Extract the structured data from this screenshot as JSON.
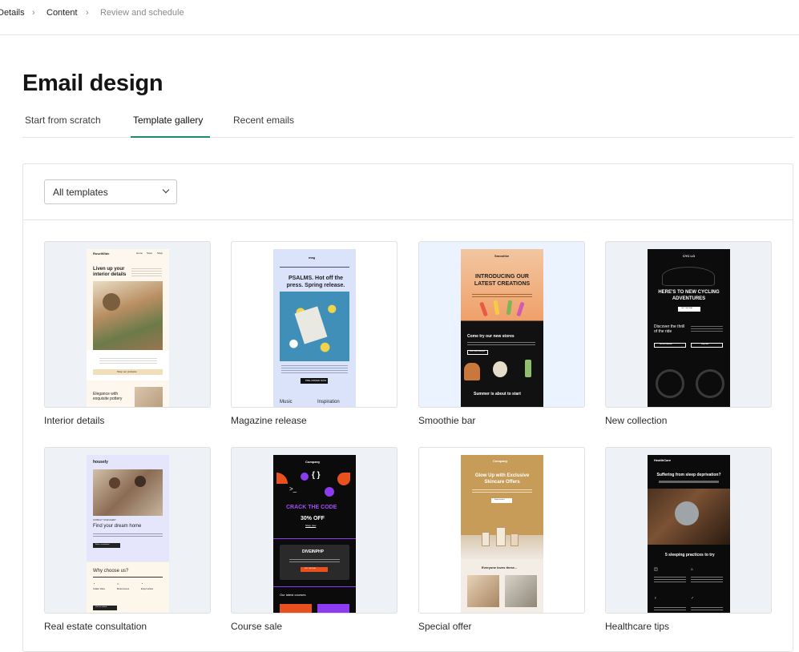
{
  "breadcrumb": {
    "items": [
      {
        "label": "Details",
        "state": "done"
      },
      {
        "label": "Content",
        "state": "done"
      },
      {
        "label": "Review and schedule",
        "state": "todo"
      }
    ]
  },
  "page_title": "Email design",
  "tabs": [
    {
      "label": "Start from scratch",
      "active": false
    },
    {
      "label": "Template gallery",
      "active": true
    },
    {
      "label": "Recent emails",
      "active": false
    }
  ],
  "filter": {
    "selected": "All templates"
  },
  "accent_color": "#1e8a6e",
  "templates": [
    {
      "name": "Interior details",
      "bg": "#eef2f7",
      "preview": {
        "brand": "RoseWilde",
        "nav": [
          "Home",
          "Store",
          "Shop"
        ],
        "headline": "Liven up your interior details",
        "button": "Shop our products",
        "footer_heading": "Elegance with exquisite pottery"
      }
    },
    {
      "name": "Magazine release",
      "bg": "#ffffff",
      "preview": {
        "brand": "mag",
        "headline": "PSALMS. Hot off the press. Spring release.",
        "button": "PRE-ORDER NOW",
        "col1": "Music",
        "col2": "Inspiration"
      }
    },
    {
      "name": "Smoothie bar",
      "bg": "#eaf3ff",
      "preview": {
        "brand": "Smoothie",
        "headline": "INTRODUCING OUR LATEST CREATIONS",
        "subhead": "Come try our new stores",
        "button": "Find a store near you",
        "footer": "Summer is about to start"
      }
    },
    {
      "name": "New collection",
      "bg": "#eef2f7",
      "preview": {
        "brand": "CYC LO",
        "headline": "HERE'S TO NEW CYCLING ADVENTURES",
        "button": "GET THE DEAL",
        "body": "Discover the thrill of the ride",
        "btn_a": "See the collection",
        "btn_b": "Shop now"
      }
    },
    {
      "name": "Real estate consultation",
      "bg": "#eef2f7",
      "preview": {
        "brand": "housely",
        "kicker": "CONSULT YOUR AGENT",
        "headline": "Find your dream home",
        "button": "Book a consultation",
        "section": "Why choose us?",
        "features": [
          "Golden Value",
          "Broad access",
          "Expert advice"
        ],
        "cta": "Visit our website"
      }
    },
    {
      "name": "Course sale",
      "bg": "#eef2f7",
      "preview": {
        "brand": "Company",
        "headline": "CRACK THE CODE",
        "offer": "30% OFF",
        "link": "Shop now",
        "product": "DIVEINPHP",
        "button": "GET THE DEAL",
        "section": "Our latest courses"
      }
    },
    {
      "name": "Special offer",
      "bg": "#ffffff",
      "preview": {
        "brand": "Company",
        "headline": "Glow Up with Exclusive Skincare Offers",
        "button": "Shop the deal",
        "section": "Everyone loves these..."
      }
    },
    {
      "name": "Healthcare tips",
      "bg": "#eef2f7",
      "preview": {
        "brand": "HealthCare",
        "headline": "Suffering from sleep deprivation?",
        "section": "5 sleeping practices to try"
      }
    }
  ]
}
